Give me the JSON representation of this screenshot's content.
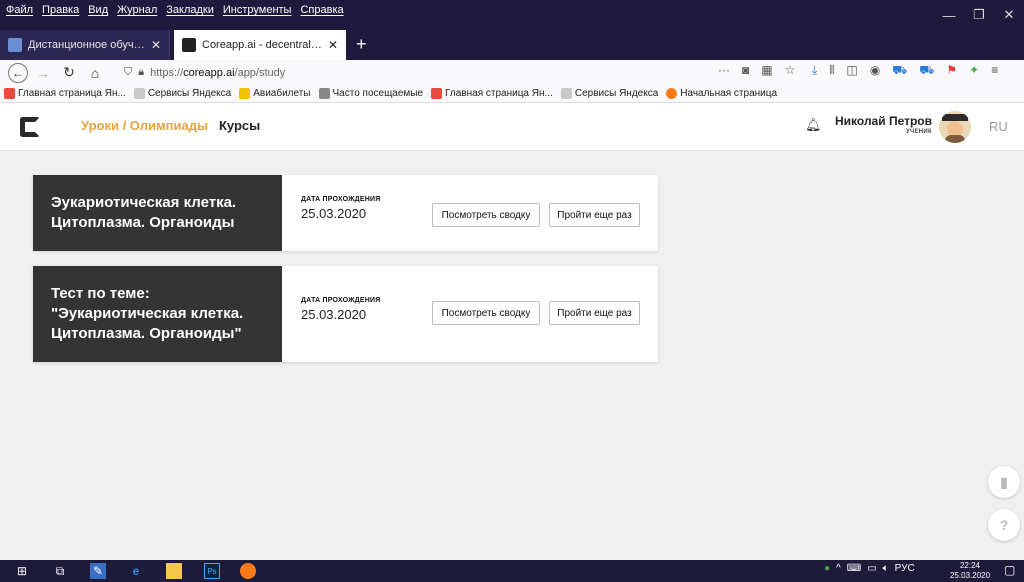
{
  "browser": {
    "menu": [
      "Файл",
      "Правка",
      "Вид",
      "Журнал",
      "Закладки",
      "Инструменты",
      "Справка"
    ],
    "tabs": [
      {
        "title": "Дистанционное обучение - К"
      },
      {
        "title": "Coreapp.ai - decentralized onli"
      }
    ],
    "url": {
      "scheme": "https://",
      "host": "coreapp.ai",
      "path": "/app/study"
    },
    "bookmarks": [
      "Главная страница Ян...",
      "Сервисы Яндекса",
      "Авиабилеты",
      "Часто посещаемые",
      "Главная страница Ян...",
      "Сервисы Яндекса",
      "Начальная страница"
    ]
  },
  "app": {
    "nav_lessons": "Уроки / Олимпиады",
    "nav_courses": "Курсы",
    "user_name": "Николай Петров",
    "user_role": "УЧЕНИК",
    "lang": "RU"
  },
  "cards": [
    {
      "title": "Эукариотическая клетка.\nЦитоплазма. Органоиды",
      "date_label": "ДАТА ПРОХОЖДЕНИЯ",
      "date": "25.03.2020",
      "summary_btn": "Посмотреть сводку",
      "retry_btn": "Пройти еще раз"
    },
    {
      "title": "Тест по теме:\n\"Эукариотическая клетка.\nЦитоплазма. Органоиды\"",
      "date_label": "ДАТА ПРОХОЖДЕНИЯ",
      "date": "25.03.2020",
      "summary_btn": "Посмотреть сводку",
      "retry_btn": "Пройти еще раз"
    }
  ],
  "taskbar": {
    "lang": "РУС",
    "time": "22:24",
    "date": "25.03.2020"
  },
  "colors": {
    "accent": "#e8a33c",
    "card_dark": "#343434",
    "chrome": "#1f1a3d"
  }
}
